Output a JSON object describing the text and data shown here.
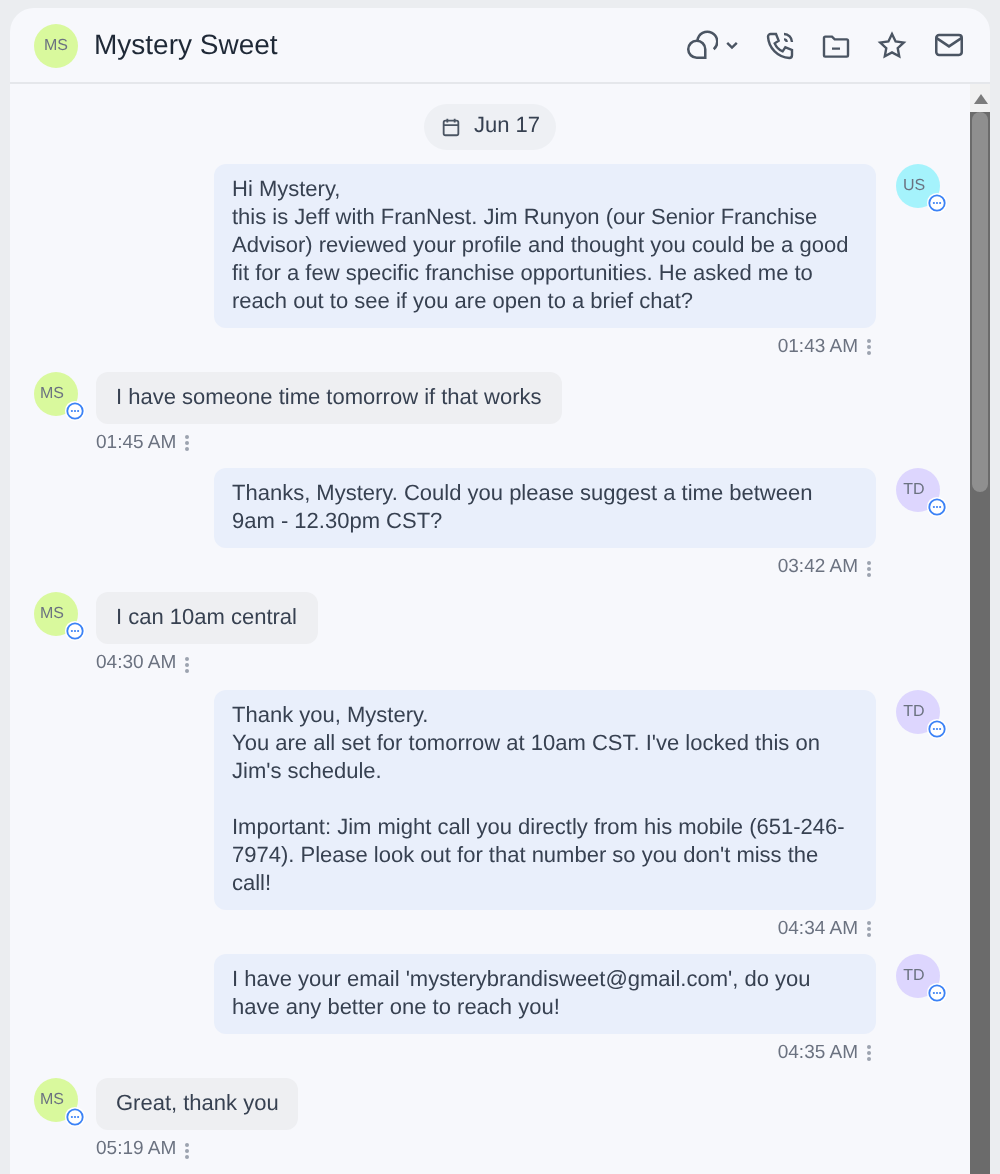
{
  "header": {
    "avatar": "MS",
    "title": "Mystery Sweet"
  },
  "date_chip": "Jun 17",
  "messages": [
    {
      "kind": "outgoing",
      "avatar": "US",
      "color": "#a5f3fc",
      "text": "Hi Mystery,\nthis is Jeff with FranNest. Jim Runyon (our Senior Franchise Advisor) reviewed your profile and thought you could be a good fit for a few specific franchise opportunities. He asked me to reach out to see if you are open to a brief chat?",
      "time": "01:43 AM"
    },
    {
      "kind": "incoming",
      "avatar": "MS",
      "color": "#d9f99d",
      "text": "I have someone time tomorrow if that works",
      "time": "01:45 AM"
    },
    {
      "kind": "outgoing",
      "avatar": "TD",
      "color": "#ddd6fe",
      "text": "Thanks, Mystery. Could you please suggest a time between 9am - 12.30pm CST?",
      "time": "03:42 AM"
    },
    {
      "kind": "incoming",
      "avatar": "MS",
      "color": "#d9f99d",
      "text": "I can 10am central",
      "time": "04:30 AM"
    },
    {
      "kind": "outgoing",
      "avatar": "TD",
      "color": "#ddd6fe",
      "text": "Thank you, Mystery.\nYou are all set for tomorrow at 10am CST. I've locked this on Jim's schedule.\n\nImportant: Jim might call you directly from his mobile (651-246-7974). Please look out for that number so you don't miss the call!",
      "time": "04:34 AM"
    },
    {
      "kind": "outgoing",
      "avatar": "TD",
      "color": "#ddd6fe",
      "text": "I have your email 'mysterybrandisweet@gmail.com', do you have any better one to reach you!",
      "time": "04:35 AM"
    },
    {
      "kind": "incoming",
      "avatar": "MS",
      "color": "#d9f99d",
      "text": "Great, thank you",
      "time": "05:19 AM"
    }
  ]
}
